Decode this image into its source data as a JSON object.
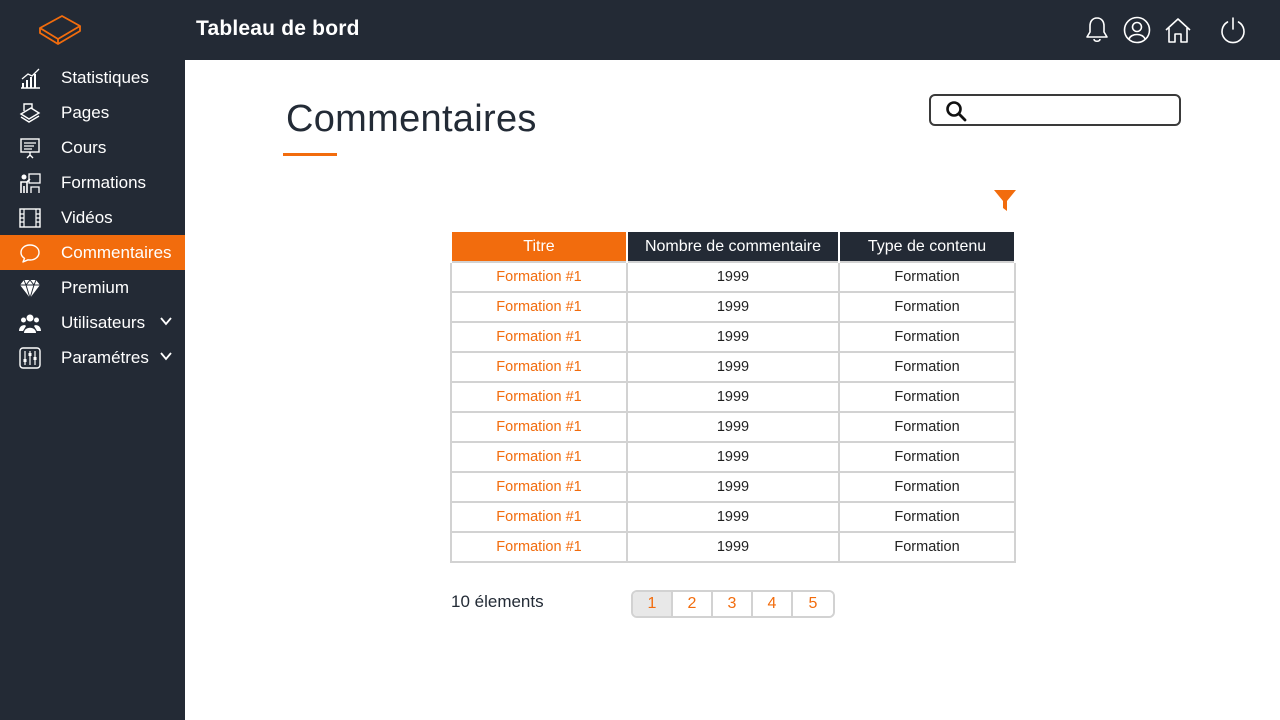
{
  "header": {
    "title": "Tableau de bord",
    "icons": [
      "bell-icon",
      "user-icon",
      "home-icon",
      "power-icon"
    ]
  },
  "sidebar": {
    "items": [
      {
        "label": "Statistiques",
        "icon": "chart-icon"
      },
      {
        "label": "Pages",
        "icon": "pages-icon"
      },
      {
        "label": "Cours",
        "icon": "presentation-icon"
      },
      {
        "label": "Formations",
        "icon": "training-icon"
      },
      {
        "label": "Vidéos",
        "icon": "film-icon"
      },
      {
        "label": "Commentaires",
        "icon": "comment-icon",
        "active": true
      },
      {
        "label": "Premium",
        "icon": "diamond-icon"
      },
      {
        "label": "Utilisateurs",
        "icon": "users-icon",
        "expandable": true
      },
      {
        "label": "Paramétres",
        "icon": "sliders-icon",
        "expandable": true
      }
    ]
  },
  "main": {
    "title": "Commentaires",
    "search": {
      "value": "",
      "placeholder": ""
    },
    "table": {
      "headers": [
        "Titre",
        "Nombre de commentaire",
        "Type de contenu"
      ],
      "rows": [
        [
          "Formation #1",
          "1999",
          "Formation"
        ],
        [
          "Formation #1",
          "1999",
          "Formation"
        ],
        [
          "Formation #1",
          "1999",
          "Formation"
        ],
        [
          "Formation #1",
          "1999",
          "Formation"
        ],
        [
          "Formation #1",
          "1999",
          "Formation"
        ],
        [
          "Formation #1",
          "1999",
          "Formation"
        ],
        [
          "Formation #1",
          "1999",
          "Formation"
        ],
        [
          "Formation #1",
          "1999",
          "Formation"
        ],
        [
          "Formation #1",
          "1999",
          "Formation"
        ],
        [
          "Formation #1",
          "1999",
          "Formation"
        ]
      ]
    },
    "count_label": "10 élements",
    "pagination": {
      "pages": [
        "1",
        "2",
        "3",
        "4",
        "5"
      ],
      "current": "1"
    }
  },
  "colors": {
    "accent": "#f26c0d",
    "dark": "#232a35",
    "border": "#d2d2d2"
  }
}
